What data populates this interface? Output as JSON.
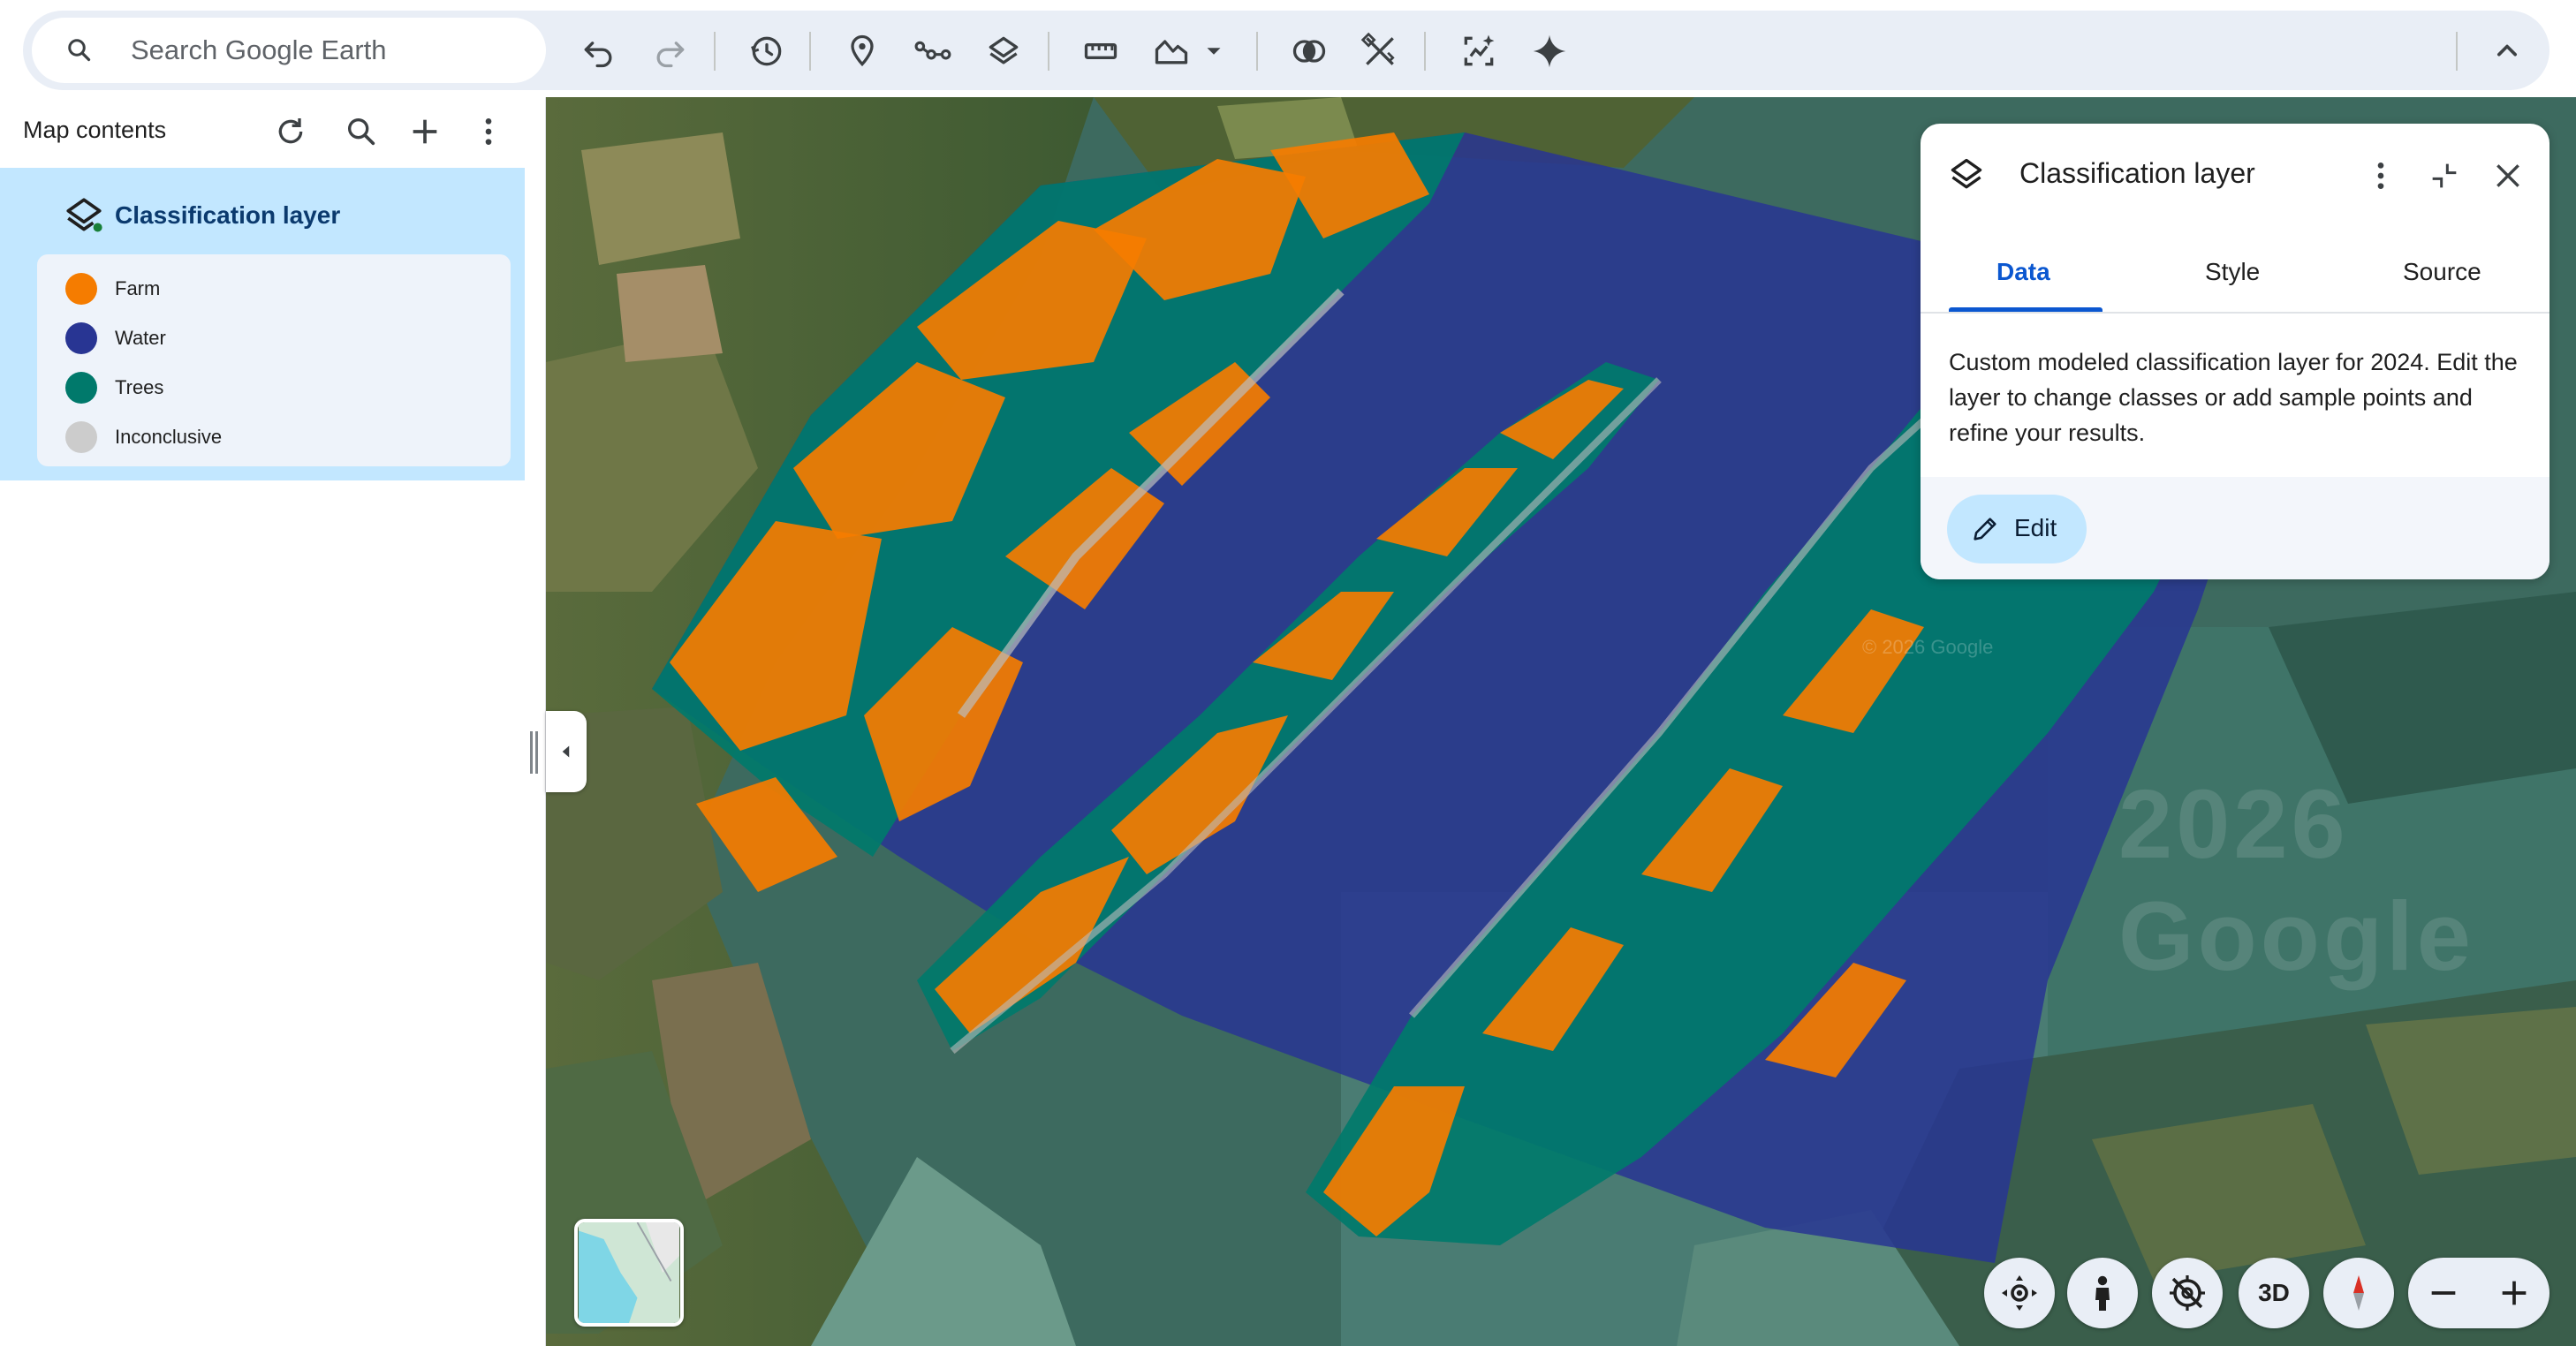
{
  "toolbar": {
    "search_placeholder": "Search Google Earth",
    "icons": [
      "search-icon",
      "undo-icon",
      "redo-icon",
      "history-icon",
      "placemark-icon",
      "path-icon",
      "layers-icon",
      "measure-icon",
      "terrain-icon",
      "dropdown-arrow-icon",
      "compare-icon",
      "tools-icon",
      "ai-analysis-icon",
      "gemini-sparkle-icon",
      "collapse-up-icon"
    ]
  },
  "sidebar": {
    "title": "Map contents",
    "layer": {
      "name": "Classification layer",
      "legend": [
        {
          "label": "Farm",
          "color": "#f57c00"
        },
        {
          "label": "Water",
          "color": "#283593"
        },
        {
          "label": "Trees",
          "color": "#00796b"
        },
        {
          "label": "Inconclusive",
          "color": "#cccccc"
        }
      ]
    }
  },
  "card": {
    "title": "Classification layer",
    "tabs": [
      {
        "label": "Data",
        "active": true
      },
      {
        "label": "Style",
        "active": false
      },
      {
        "label": "Source",
        "active": false
      }
    ],
    "description": "Custom modeled classification layer for 2024. Edit the layer to change classes or add sample points and refine your results.",
    "edit_label": "Edit"
  },
  "map": {
    "watermark": "© 2026 Google",
    "watermark_large": "2026 Google",
    "class_colors": {
      "farm": "#f57c00",
      "water": "#283593",
      "trees": "#00796b",
      "inconclusive": "#bdbdbd"
    }
  },
  "controls": {
    "three_d_label": "3D"
  }
}
